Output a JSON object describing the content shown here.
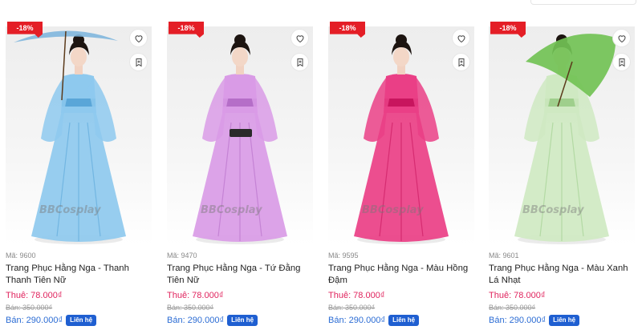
{
  "products": [
    {
      "discount": "-18%",
      "code": "Mã: 9600",
      "name": "Trang Phục Hằng Nga - Thanh Thanh Tiên Nữ",
      "rent": "Thuê: 78.000₫",
      "old_price": "Bán: 350.000₫",
      "sale": "Bán: 290.000₫",
      "contact": "Liên hệ",
      "watermark": "BBCosplay",
      "dress_color": "#8ec9ee",
      "accent_color": "#5aa6d8",
      "prop": "umbrella",
      "prop_color": "#7fb6dd"
    },
    {
      "discount": "-18%",
      "code": "Mã: 9470",
      "name": "Trang Phục Hằng Nga - Tứ Đằng Tiên Nữ",
      "rent": "Thuê: 78.000₫",
      "old_price": "Bán: 350.000₫",
      "sale": "Bán: 290.000₫",
      "contact": "Liên hệ",
      "watermark": "BBCosplay",
      "dress_color": "#d99be6",
      "accent_color": "#b56ec8",
      "prop": "clutch",
      "prop_color": "#2a2a2a"
    },
    {
      "discount": "-18%",
      "code": "Mã: 9595",
      "name": "Trang Phục Hằng Nga - Màu Hồng Đậm",
      "rent": "Thuê: 78.000₫",
      "old_price": "Bán: 350.000₫",
      "sale": "Bán: 290.000₫",
      "contact": "Liên hệ",
      "watermark": "BBCosplay",
      "dress_color": "#ea3f86",
      "accent_color": "#c8155e",
      "prop": "none",
      "prop_color": "#000000"
    },
    {
      "discount": "-18%",
      "code": "Mã: 9601",
      "name": "Trang Phục Hằng Nga - Màu Xanh Lá Nhạt",
      "rent": "Thuê: 78.000₫",
      "old_price": "Bán: 350.000₫",
      "sale": "Bán: 290.000₫",
      "contact": "Liên hệ",
      "watermark": "BBCosplay",
      "dress_color": "#cfe9c2",
      "accent_color": "#9fcf8c",
      "prop": "umbrella",
      "prop_color": "#72c255"
    }
  ],
  "colors": {
    "discount_badge": "#e41e26",
    "rent_price": "#e0245e",
    "sale_price": "#2b6cd4",
    "contact_button": "#1f5fd1"
  },
  "icons": [
    "heart-icon",
    "bookmark-plus-icon"
  ]
}
